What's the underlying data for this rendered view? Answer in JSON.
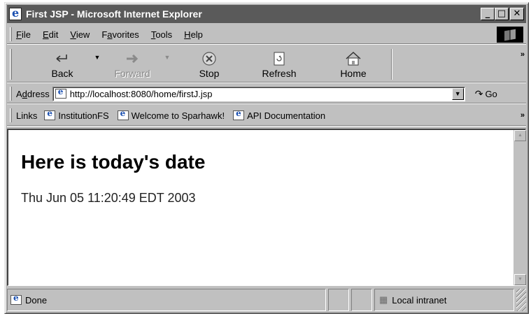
{
  "window": {
    "title": "First JSP - Microsoft Internet Explorer",
    "controls": {
      "minimize": "_",
      "maximize": "□",
      "close": "✕"
    }
  },
  "menubar": {
    "items": [
      {
        "label_pre": "",
        "accel": "F",
        "label_post": "ile"
      },
      {
        "label_pre": "",
        "accel": "E",
        "label_post": "dit"
      },
      {
        "label_pre": "",
        "accel": "V",
        "label_post": "iew"
      },
      {
        "label_pre": "F",
        "accel": "a",
        "label_post": "vorites"
      },
      {
        "label_pre": "",
        "accel": "T",
        "label_post": "ools"
      },
      {
        "label_pre": "",
        "accel": "H",
        "label_post": "elp"
      }
    ]
  },
  "toolbar": {
    "back": {
      "label": "Back",
      "icon": "back-arrow-icon"
    },
    "forward": {
      "label": "Forward",
      "icon": "forward-arrow-icon",
      "enabled": false
    },
    "stop": {
      "label": "Stop",
      "icon": "stop-icon"
    },
    "refresh": {
      "label": "Refresh",
      "icon": "refresh-icon"
    },
    "home": {
      "label": "Home",
      "icon": "home-icon"
    },
    "overflow": "»"
  },
  "address": {
    "label": "Address",
    "accel": "d",
    "value": "http://localhost:8080/home/firstJ.jsp",
    "go_label": "Go"
  },
  "links": {
    "label": "Links",
    "items": [
      "InstitutionFS",
      "Welcome to Sparhawk!",
      "API Documentation"
    ],
    "overflow": "»"
  },
  "content": {
    "heading": "Here is today's date",
    "date_text": "Thu Jun 05 11:20:49 EDT 2003"
  },
  "status": {
    "text": "Done",
    "zone": "Local intranet"
  }
}
